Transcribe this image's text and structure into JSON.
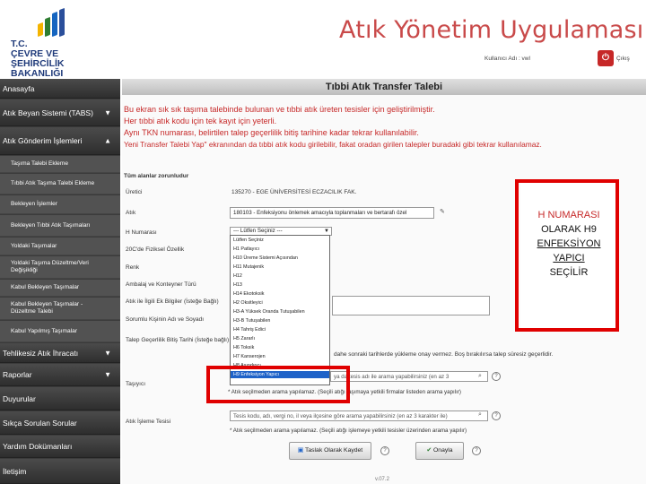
{
  "header": {
    "ministry_lines": [
      "T.C.",
      "ÇEVRE VE ŞEHİRCİLİK",
      "BAKANLIĞI"
    ],
    "app_title": "Atık Yönetim Uygulaması",
    "user_label": "Kullanıcı Adı : vwl",
    "logout_label": "Çıkış"
  },
  "sidebar": {
    "items": [
      {
        "label": "Anasayfa",
        "type": "main",
        "arrow": ""
      },
      {
        "label": "Atık Beyan Sistemi (TABS)",
        "type": "main",
        "arrow": "▼"
      },
      {
        "label": "Atık Gönderim İşlemleri",
        "type": "main",
        "arrow": "▲"
      },
      {
        "label": "Taşıma Talebi Ekleme",
        "type": "sub"
      },
      {
        "label": "Tıbbi Atık Taşıma Talebi Ekleme",
        "type": "sub"
      },
      {
        "label": "Bekleyen İşlemler",
        "type": "sub"
      },
      {
        "label": "Bekleyen Tıbbi Atık Taşımaları",
        "type": "sub"
      },
      {
        "label": "Yoldaki Taşımalar",
        "type": "sub"
      },
      {
        "label": "Yoldaki Taşıma Düzeltme/Veri Değişikliği",
        "type": "sub"
      },
      {
        "label": "Kabul Bekleyen Taşımalar",
        "type": "sub"
      },
      {
        "label": "Kabul Bekleyen Taşımalar - Düzeltme Talebi",
        "type": "sub"
      },
      {
        "label": "Kabul Yapılmış Taşımalar",
        "type": "sub"
      },
      {
        "label": "Tehlikesiz Atık İhracatı",
        "type": "main",
        "arrow": "▼"
      },
      {
        "label": "Raporlar",
        "type": "main",
        "arrow": "▼"
      },
      {
        "label": "Duyurular",
        "type": "main",
        "arrow": ""
      },
      {
        "label": "Sıkça Sorulan Sorular",
        "type": "main",
        "arrow": ""
      },
      {
        "label": "Yardım Dokümanları",
        "type": "main",
        "arrow": ""
      },
      {
        "label": "İletişim",
        "type": "main",
        "arrow": ""
      }
    ]
  },
  "form": {
    "title": "Tıbbi Atık Transfer Talebi",
    "info_lines": [
      "Bu ekran sık sık taşıma talebinde bulunan ve tıbbi atık üreten tesisler için geliştirilmiştir.",
      "Her tıbbi atık kodu için tek kayıt için yeterli.",
      "Aynı TKN numarası, belirtilen talep geçerlilik bitiş tarihine kadar tekrar kullanılabilir.",
      "Yeni Transfer Talebi Yap\" ekranından da tıbbi atık kodu girilebilir, fakat oradan girilen talepler buradaki gibi tekrar kullanılamaz."
    ],
    "required_note": "Tüm alanlar zorunludur",
    "labels": {
      "tesis": "Üretici",
      "atik": "Atık",
      "h_numarasi": "H Numarası",
      "ozellik": "20C'de Fiziksel Özellik",
      "renk": "Renk",
      "ambalaj": "Ambalaj ve Konteyner Türü",
      "ek_bilgi": "Atık ile İlgili Ek Bilgiler (İsteğe Bağlı)",
      "sorumlu": "Sorumlu Kişinin Adı ve Soyadı",
      "gecerlilik": "Talep Geçerlilik Bitiş Tarihi (İsteğe bağlı)",
      "tasiyici": "Taşıyıcı",
      "isleme": "Atık İşleme Tesisi"
    },
    "tesis_value": "135270 - EGE ÜNİVERSİTESİ ECZACILIK FAK.",
    "atik_value": "180103 - Enfeksiyonu önlemek amacıyla toplanmaları ve bertarafı özel",
    "h_select_value": "--- Lütfen Seçiniz ---",
    "h_options": [
      "Lütfen Seçiniz",
      "H1 Patlayıcı",
      "H10 Üreme Sistemi Açısından",
      "H11 Mutajenik",
      "H12",
      "H13",
      "H14 Ekotoksik",
      "H2 Oksitleyici",
      "H3-A Yüksek Oranda Tutuşabilen",
      "H3-B Tutuşabilen",
      "H4 Tahriş Edici",
      "H5 Zararlı",
      "H6 Toksik",
      "H7 Kanserojen",
      "H8 Aşındırıcı",
      "H9 Enfeksiyon Yapıcı"
    ],
    "gecerlilik_note": "dahe sonraki tarihlerde yükleme onay vermez. Boş bırakılırsa talep süresiz geçerlidir.",
    "tasiyici_placeholder": "ya da tesis adı ile arama yapabilirsiniz (en az 3",
    "tasiyici_hint": "* Atık seçilmeden arama yapılamaz. (Seçili atığı taşımaya yetkili firmalar listeden arama yapılır)",
    "isleme_placeholder": "Tesis kodu, adı, vergi no, il veya ilçesine göre arama yapabilirsiniz (en az 3 karakter ile)",
    "isleme_hint": "* Atık seçilmeden arama yapılamaz. (Seçili atığı işlemeye yetkili tesisler üzerinden arama yapılır)",
    "save_draft_label": "Taslak Olarak Kaydet",
    "approve_label": "Onayla",
    "version_text": "v.07.2"
  },
  "callout": {
    "lines": [
      "H NUMARASI",
      "OLARAK H9",
      "ENFEKSİYON",
      "YAPICI",
      "SEÇİLİR"
    ]
  },
  "colors": {
    "annotation_red": "#e00000",
    "info_red": "#c62828",
    "sidebar_bg": "#3b3b3b",
    "title_red": "#c94a4a",
    "ministry_blue": "#1f3a7a",
    "selected_option_blue": "#1e62c8"
  }
}
